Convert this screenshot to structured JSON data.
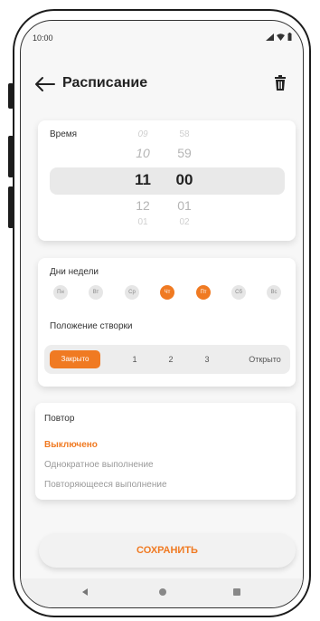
{
  "status": {
    "time": "10:00"
  },
  "header": {
    "title": "Расписание"
  },
  "time_card": {
    "label": "Время",
    "hours": [
      "09",
      "10",
      "11",
      "12",
      "01"
    ],
    "minutes": [
      "58",
      "59",
      "00",
      "01",
      "02"
    ]
  },
  "days_card": {
    "label": "Дни недели",
    "days": [
      {
        "label": "Пн",
        "selected": false
      },
      {
        "label": "Вт",
        "selected": false
      },
      {
        "label": "Ср",
        "selected": false
      },
      {
        "label": "Чт",
        "selected": true
      },
      {
        "label": "Пт",
        "selected": true
      },
      {
        "label": "Сб",
        "selected": false
      },
      {
        "label": "Вс",
        "selected": false
      }
    ],
    "position_label": "Положение створки",
    "positions": [
      "Закрыто",
      "1",
      "2",
      "3",
      "Открыто"
    ],
    "selected_position": "Закрыто"
  },
  "repeat_card": {
    "label": "Повтор",
    "options": [
      {
        "label": "Выключено",
        "selected": true
      },
      {
        "label": "Однократное выполнение",
        "selected": false
      },
      {
        "label": "Повторяющееся выполнение",
        "selected": false
      }
    ]
  },
  "save_button": {
    "label": "СОХРАНИТЬ"
  },
  "colors": {
    "accent": "#f07a22",
    "background": "#f7f7f7",
    "card": "#ffffff"
  },
  "icons": {
    "back": "arrow-left-icon",
    "trash": "trash-icon",
    "signal": "signal-icon",
    "wifi": "wifi-icon",
    "battery": "battery-icon"
  }
}
